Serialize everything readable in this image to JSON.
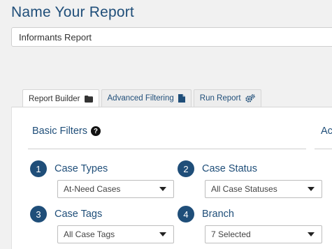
{
  "page": {
    "title": "Name Your Report",
    "report_name_value": "Informants Report"
  },
  "tabs": [
    {
      "label": "Report Builder",
      "icon": "folder-icon",
      "active": true
    },
    {
      "label": "Advanced Filtering",
      "icon": "file-icon",
      "active": false
    },
    {
      "label": "Run Report",
      "icon": "cogs-icon",
      "active": false
    }
  ],
  "basic_filters": {
    "title": "Basic Filters",
    "help_icon": "question-circle-icon"
  },
  "next_section_title": "Ac",
  "filters": [
    {
      "number": "1",
      "label": "Case Types",
      "value": "At-Need Cases"
    },
    {
      "number": "2",
      "label": "Case Status",
      "value": "All Case Statuses"
    },
    {
      "number": "3",
      "label": "Case Tags",
      "value": "All Case Tags"
    },
    {
      "number": "4",
      "label": "Branch",
      "value": "7 Selected"
    }
  ],
  "colors": {
    "accent": "#1f4e79",
    "background": "#f1f1f1",
    "panel": "#ffffff"
  }
}
